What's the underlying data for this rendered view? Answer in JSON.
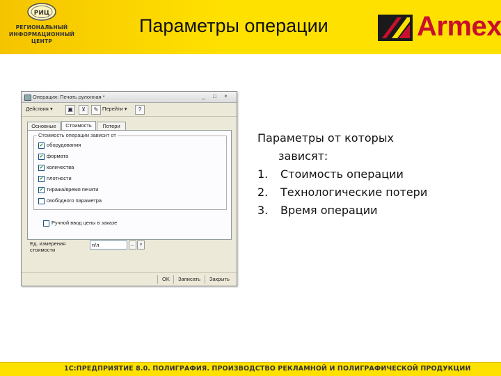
{
  "header": {
    "title": "Параметры операции",
    "rmc_logo_text": [
      "РЕГИОНАЛЬНЫЙ",
      "ИНФОРМАЦИОННЫЙ",
      "ЦЕНТР"
    ],
    "rmc_emblem_text": "РИЦ",
    "brand_name": "Armex",
    "brand_color": "#c8102e",
    "background_color": "#ffe100"
  },
  "screenshot": {
    "window_title": "Операция: Печать рулонная *",
    "window_buttons": [
      "minimize",
      "maximize",
      "close"
    ],
    "toolbar": {
      "actions_label": "Действия ▾",
      "goto_label": "Перейти ▾",
      "icons": [
        "save-icon",
        "filter-icon",
        "edit-icon",
        "help-icon"
      ]
    },
    "tabs": [
      {
        "label": "Основные",
        "active": false
      },
      {
        "label": "Стоимость",
        "active": true
      },
      {
        "label": "Потери",
        "active": false
      }
    ],
    "group_title": "Стоимость операции зависит от",
    "checkboxes": [
      {
        "label": "оборудования",
        "checked": true
      },
      {
        "label": "формата",
        "checked": true
      },
      {
        "label": "количества",
        "checked": true
      },
      {
        "label": "плотности",
        "checked": true
      },
      {
        "label": "тиража/время печати",
        "checked": true
      },
      {
        "label": "свободного параметра",
        "checked": false
      }
    ],
    "manual_price_label": "Ручной ввод цены в заказе",
    "manual_price_checked": false,
    "unit_label": "Ед. измерения стоимости",
    "unit_value": "п/л",
    "bottom_buttons": [
      "OK",
      "Записать",
      "Закрыть"
    ]
  },
  "info": {
    "heading_line1": "Параметры от которых",
    "heading_line2": "зависят:",
    "items": [
      {
        "num": "1.",
        "text": "Стоимость операции"
      },
      {
        "num": "2.",
        "text": "Технологические потери"
      },
      {
        "num": "3.",
        "text": "Время операции"
      }
    ]
  },
  "footer": {
    "text": "1С:ПРЕДПРИЯТИЕ 8.0. ПОЛИГРАФИЯ. ПРОИЗВОДСТВО РЕКЛАМНОЙ И ПОЛИГРАФИЧЕСКОЙ ПРОДУКЦИИ"
  }
}
